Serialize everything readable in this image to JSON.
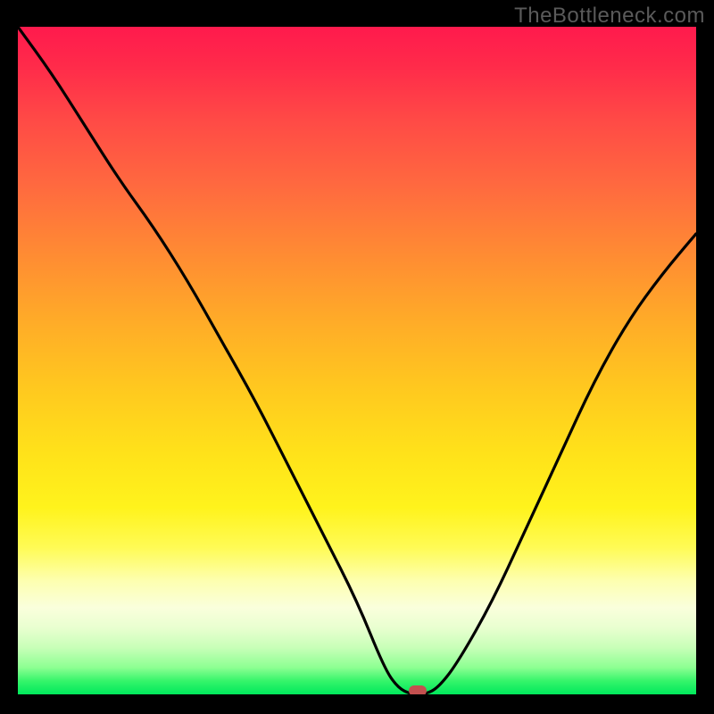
{
  "watermark": "TheBottleneck.com",
  "colors": {
    "frame_bg": "#000000",
    "curve": "#000000",
    "marker": "#c3504f",
    "watermark_text": "#5a5a5a"
  },
  "chart_data": {
    "type": "line",
    "title": "",
    "xlabel": "",
    "ylabel": "",
    "xlim": [
      0,
      100
    ],
    "ylim": [
      0,
      100
    ],
    "grid": false,
    "legend": false,
    "background_gradient": {
      "direction": "vertical",
      "top": "red-pink",
      "mid": "orange-yellow",
      "bottom_band": "pale-yellow-to-green",
      "bottom_edge": "bright-green"
    },
    "series": [
      {
        "name": "bottleneck-curve",
        "x": [
          0,
          5,
          10,
          15,
          20,
          25,
          30,
          35,
          40,
          45,
          50,
          54,
          56,
          58,
          60,
          62,
          65,
          70,
          75,
          80,
          85,
          90,
          95,
          100
        ],
        "y": [
          100,
          93,
          85,
          77,
          70,
          62,
          53,
          44,
          34,
          24,
          14,
          4,
          1,
          0,
          0,
          1,
          5,
          14,
          25,
          36,
          47,
          56,
          63,
          69
        ]
      }
    ],
    "marker": {
      "x": 59,
      "y": 0
    }
  }
}
